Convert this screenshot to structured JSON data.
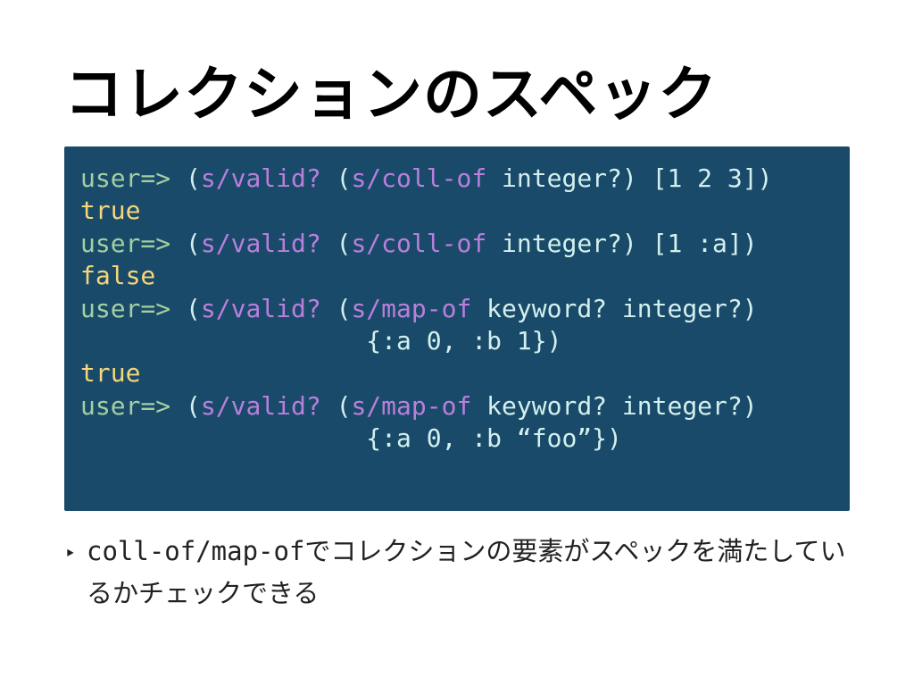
{
  "title": "コレクションのスペック",
  "code": {
    "l1_prompt": "user=>",
    "l1_open": " (",
    "l1_fn": "s/valid?",
    "l1_sp": " (",
    "l1_fn2": "s/coll-of",
    "l1_arg": " integer?",
    "l1_close": ") ",
    "l1_vec": "[1 2 3]",
    "l1_end": ")",
    "l2_result": "true",
    "l3_prompt": "user=>",
    "l3_open": " (",
    "l3_fn": "s/valid?",
    "l3_sp": " (",
    "l3_fn2": "s/coll-of",
    "l3_arg": " integer?",
    "l3_close": ") ",
    "l3_vec": "[1 :a]",
    "l3_end": ")",
    "l4_result": "false",
    "l5_prompt": "user=>",
    "l5_open": " (",
    "l5_fn": "s/valid?",
    "l5_sp": " (",
    "l5_fn2": "s/map-of",
    "l5_arg": " keyword? integer?",
    "l5_close": ")",
    "l6_indent": "                   ",
    "l6_map": "{:a 0, :b 1}",
    "l6_end": ")",
    "l7_result": "true",
    "l8_prompt": "user=>",
    "l8_open": " (",
    "l8_fn": "s/valid?",
    "l8_sp": " (",
    "l8_fn2": "s/map-of",
    "l8_arg": " keyword? integer?",
    "l8_close": ")",
    "l9_indent": "                   ",
    "l9_map": "{:a 0, :b “foo”}",
    "l9_end": ")"
  },
  "bullet": {
    "marker": "‣",
    "mono": "coll-of/map-of",
    "rest": "でコレクションの要素がスペックを満たしているかチェックできる"
  }
}
